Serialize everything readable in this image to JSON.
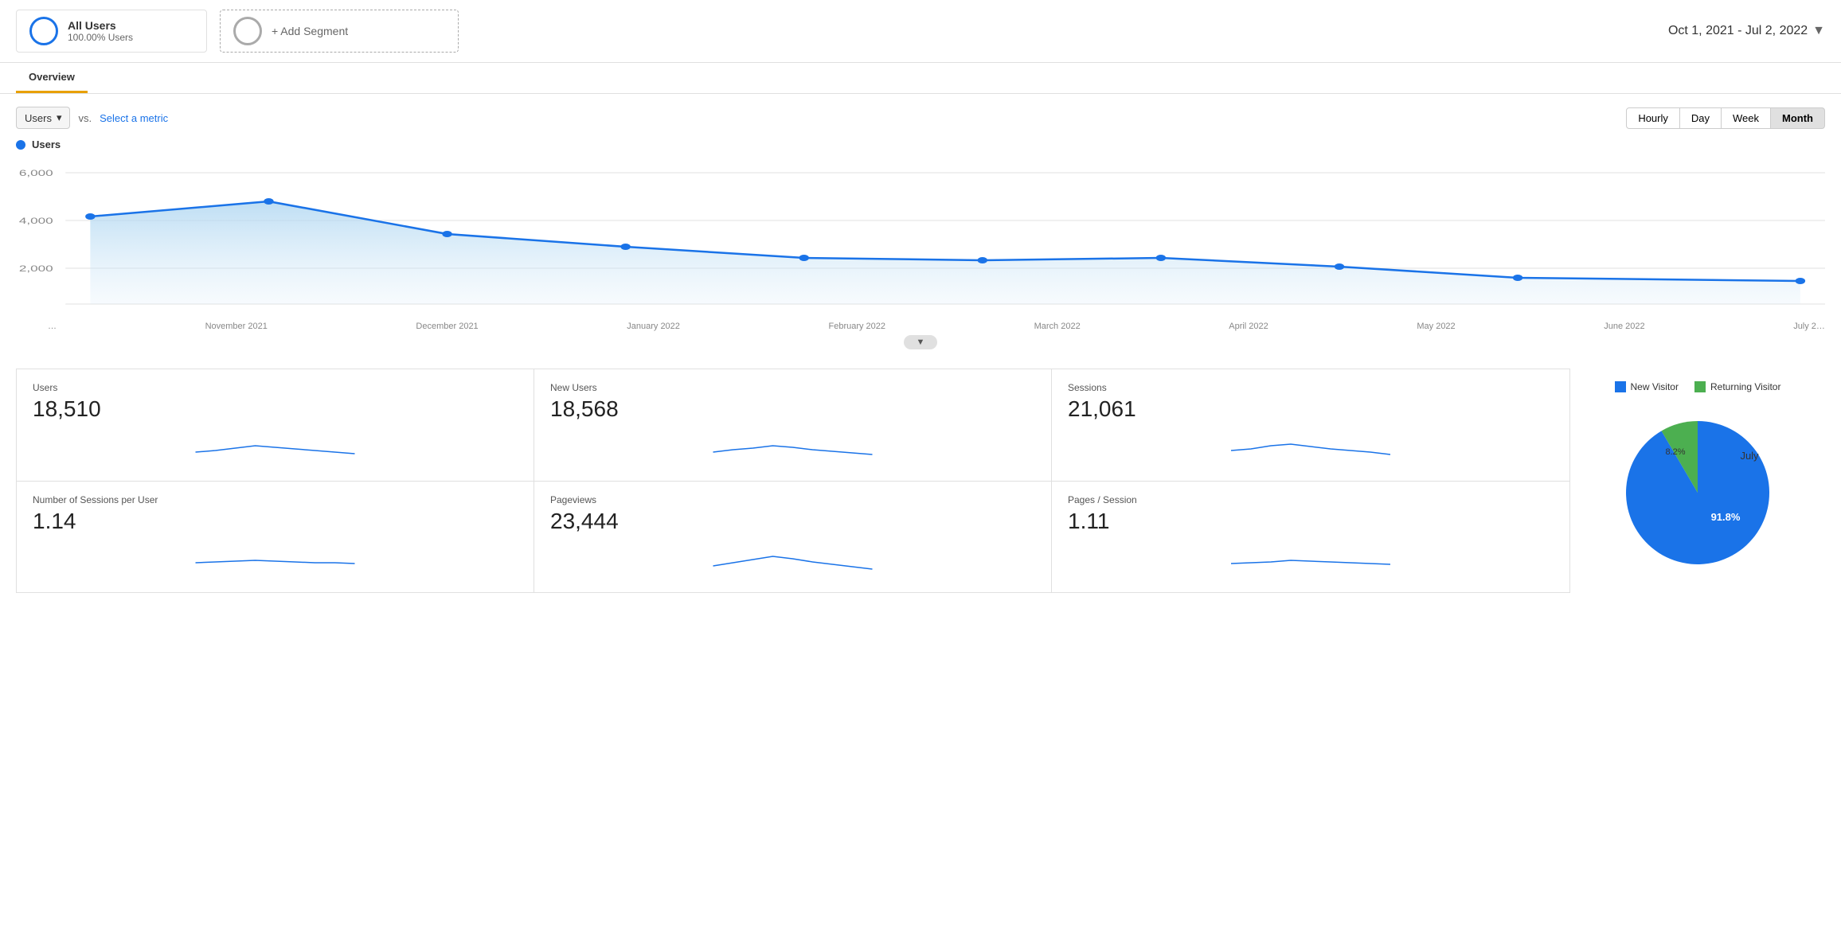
{
  "header": {
    "segment1": {
      "label": "All Users",
      "sub": "100.00% Users"
    },
    "segment2": {
      "label": "+ Add Segment"
    },
    "dateRange": "Oct 1, 2021 - Jul 2, 2022"
  },
  "tabs": [
    {
      "id": "overview",
      "label": "Overview",
      "active": true
    }
  ],
  "chart": {
    "metric_label": "Users",
    "metric_btn": "Users",
    "vs_label": "vs.",
    "select_metric": "Select a metric",
    "time_buttons": [
      "Hourly",
      "Day",
      "Week",
      "Month"
    ],
    "active_time": "Month",
    "y_labels": [
      "6,000",
      "4,000",
      "2,000"
    ],
    "x_labels": [
      "…",
      "November 2021",
      "December 2021",
      "January 2022",
      "February 2022",
      "March 2022",
      "April 2022",
      "May 2022",
      "June 2022",
      "July 2…"
    ]
  },
  "metrics": [
    {
      "name": "Users",
      "value": "18,510"
    },
    {
      "name": "New Users",
      "value": "18,568"
    },
    {
      "name": "Sessions",
      "value": "21,061"
    },
    {
      "name": "Number of Sessions per User",
      "value": "1.14"
    },
    {
      "name": "Pageviews",
      "value": "23,444"
    },
    {
      "name": "Pages / Session",
      "value": "1.11"
    }
  ],
  "pie": {
    "legend": [
      {
        "color": "blue",
        "label": "New Visitor"
      },
      {
        "color": "green",
        "label": "Returning Visitor"
      }
    ],
    "slices": [
      {
        "label": "New Visitor",
        "value": 91.8,
        "color": "#1a73e8"
      },
      {
        "label": "Returning Visitor",
        "value": 8.2,
        "color": "#4caf50"
      }
    ],
    "new_visitor_pct": "91.8%",
    "returning_visitor_pct": "8.2%"
  },
  "july_label": "July"
}
